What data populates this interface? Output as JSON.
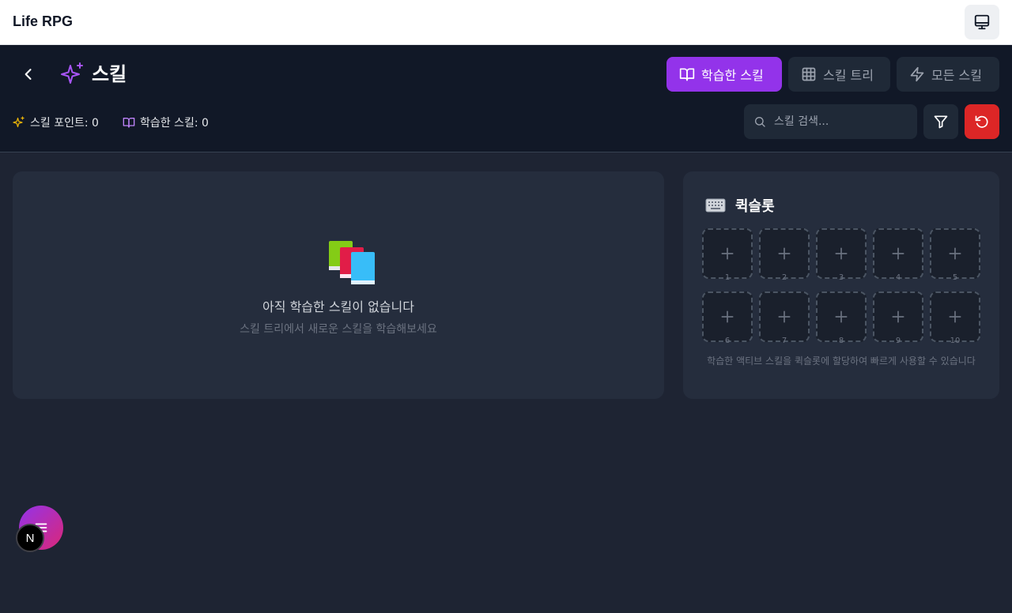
{
  "app": {
    "title": "Life RPG"
  },
  "header": {
    "title": "스킬",
    "tabs": [
      {
        "label": "학습한 스킬",
        "icon": "book-open-icon",
        "active": true
      },
      {
        "label": "스킬 트리",
        "icon": "grid-icon",
        "active": false
      },
      {
        "label": "모든 스킬",
        "icon": "zap-icon",
        "active": false
      }
    ],
    "stats": {
      "skill_points": "스킬 포인트: 0",
      "learned_skills": "학습한 스킬: 0"
    },
    "search": {
      "placeholder": "스킬 검색..."
    }
  },
  "skills": {
    "empty_title": "아직 학습한 스킬이 없습니다",
    "empty_subtitle": "스킬 트리에서 새로운 스킬을 학습해보세요"
  },
  "quickslot": {
    "title": "퀵슬롯",
    "slots": [
      "1",
      "2",
      "3",
      "4",
      "5",
      "6",
      "7",
      "8",
      "9",
      "10"
    ],
    "hint": "학습한 액티브 스킬을 퀵슬롯에 할당하여 빠르게 사용할 수 있습니다"
  },
  "fab": {
    "badge": "N"
  },
  "colors": {
    "accent": "#9333ea",
    "danger": "#dc2626",
    "header_bg": "#111827",
    "panel_bg": "#252d3d",
    "points_icon": "#eab308",
    "learned_icon": "#c084fc"
  }
}
